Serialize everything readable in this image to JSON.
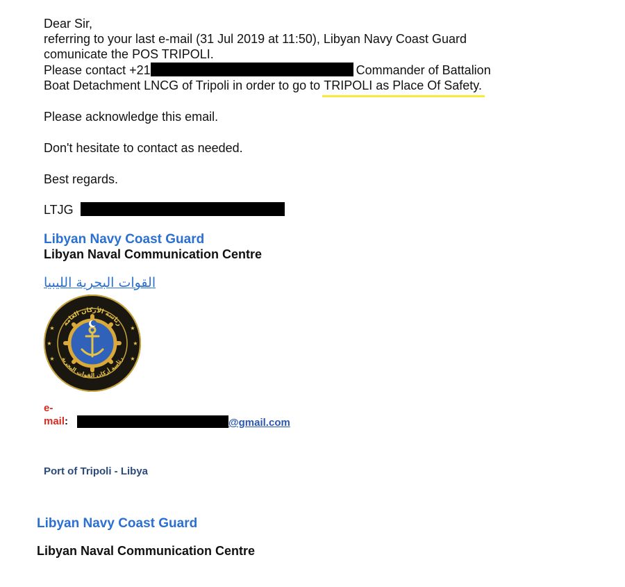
{
  "email": {
    "greeting": "Dear Sir,",
    "line1": "referring to your last e-mail (31 Jul 2019 at 11:50), Libyan Navy Coast Guard",
    "line2": "comunicate the POS TRIPOLI.",
    "line3_prefix": "Please contact +21",
    "line3_suffix": "Commander of Battalion",
    "line4_prefix": "Boat Detachment LNCG of Tripoli in order to go to ",
    "line4_highlight": "TRIPOLI as Place Of Safety.",
    "ack": "Please acknowledge this email.",
    "contact": "Don't hesitate to contact as needed.",
    "regards": "Best regards.",
    "rank": "LTJG"
  },
  "signature": {
    "org_blue": "Libyan Navy Coast Guard",
    "org_black": "Libyan Naval Communication Centre",
    "arabic_link": "القوات البحرية الليبيا",
    "email_label_line1": "e-",
    "email_label_line2": "mail",
    "email_colon": ":",
    "email_domain": "@gmail.com",
    "port": "Port of Tripoli - Libya",
    "footer_blue": "Libyan Navy Coast Guard",
    "footer_black": "Libyan Naval Communication Centre"
  },
  "colors": {
    "highlight_underline": "#f5ec3a",
    "org_blue": "#2a6fd2",
    "label_red": "#d82a1e",
    "port_navy": "#2a4a7a",
    "redaction": "#000000"
  },
  "emblem": {
    "icon": "navy-emblem-icon",
    "arabic_top": "رئاسة الأركان العامة",
    "arabic_bottom": "رئاسة أركان القوات البحرية"
  }
}
